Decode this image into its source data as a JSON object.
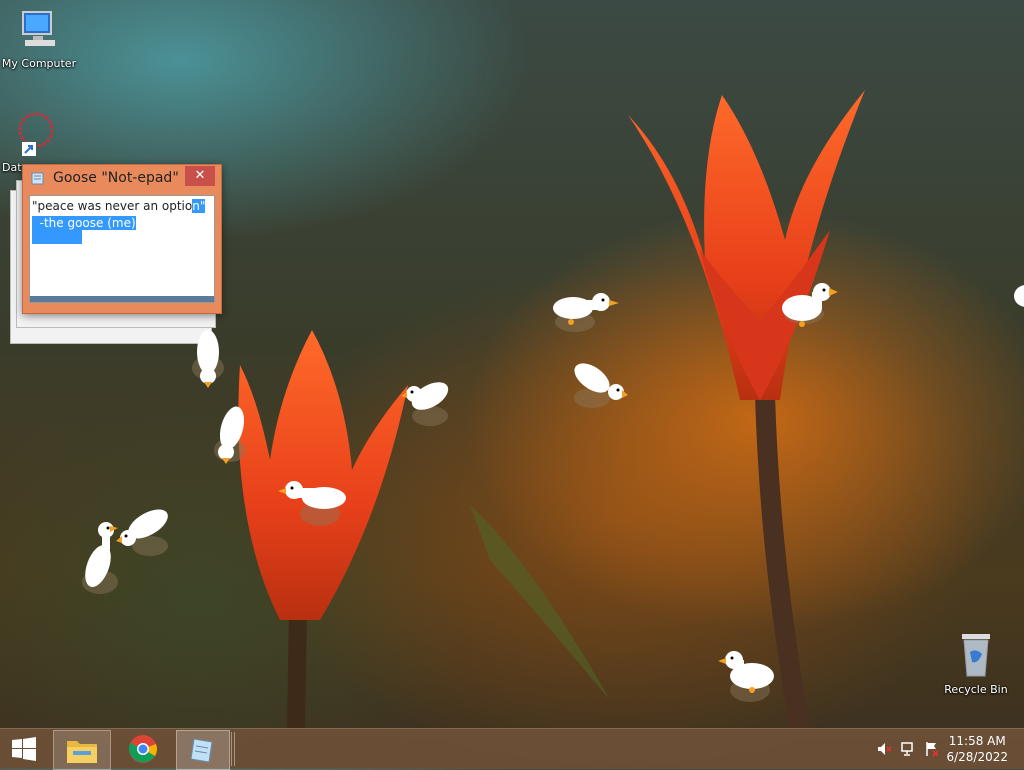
{
  "desktop": {
    "icons": [
      {
        "label": "My Computer",
        "icon": "computer-icon"
      },
      {
        "label": "Dat",
        "icon": "shortcut-icon"
      },
      {
        "label": "Recycle Bin",
        "icon": "recycle-bin-icon"
      }
    ]
  },
  "notepad": {
    "title": "Goose \"Not-epad\"",
    "close_label": "✕",
    "line1_plain": "\"peace was never an optio",
    "line1_selected": "n\"",
    "line2": "  -the goose (me)"
  },
  "taskbar": {
    "start_icon": "windows-logo-icon",
    "apps": [
      {
        "name": "File Explorer",
        "icon": "folder-icon"
      },
      {
        "name": "Google Chrome",
        "icon": "chrome-icon"
      },
      {
        "name": "Notepad",
        "icon": "notepad-icon"
      }
    ],
    "tray": {
      "icons": [
        "volume-muted-icon",
        "network-icon",
        "action-center-flag-icon"
      ],
      "time": "11:58 AM",
      "date": "6/28/2022"
    }
  },
  "colors": {
    "taskbar": "#6e5037",
    "window_border": "#e88a5c",
    "close_button": "#c7504a",
    "selection": "#3399ff"
  }
}
